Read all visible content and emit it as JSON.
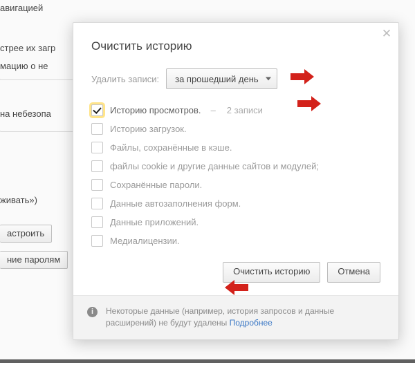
{
  "background": {
    "frag_nav": "авигацией",
    "frag_fast": "стрее их загр",
    "frag_info": "мацию о не",
    "frag_unsafe": "на небезопа",
    "frag_show": "живать»)",
    "btn_configure": "астроить",
    "btn_passwords": "ние паролям"
  },
  "modal": {
    "title": "Очистить историю",
    "delete_label": "Удалить записи:",
    "period_value": "за прошедший день",
    "items": [
      {
        "label": "Историю просмотров.",
        "count_text": "2 записи",
        "checked": true,
        "active": true
      },
      {
        "label": "Историю загрузок.",
        "checked": false,
        "active": false
      },
      {
        "label": "Файлы, сохранённые в кэше.",
        "checked": false,
        "active": false
      },
      {
        "label": "файлы cookie и другие данные сайтов и модулей;",
        "checked": false,
        "active": false
      },
      {
        "label": "Сохранённые пароли.",
        "checked": false,
        "active": false
      },
      {
        "label": "Данные автозаполнения форм.",
        "checked": false,
        "active": false
      },
      {
        "label": "Данные приложений.",
        "checked": false,
        "active": false
      },
      {
        "label": "Медиалицензии.",
        "checked": false,
        "active": false
      }
    ],
    "btn_clear": "Очистить историю",
    "btn_cancel": "Отмена",
    "footer_text": "Некоторые данные (например, история запросов и данные расширений) не будут удалены ",
    "footer_link": "Подробнее"
  },
  "glyphs": {
    "close": "✕",
    "info": "i",
    "dash": "–"
  }
}
